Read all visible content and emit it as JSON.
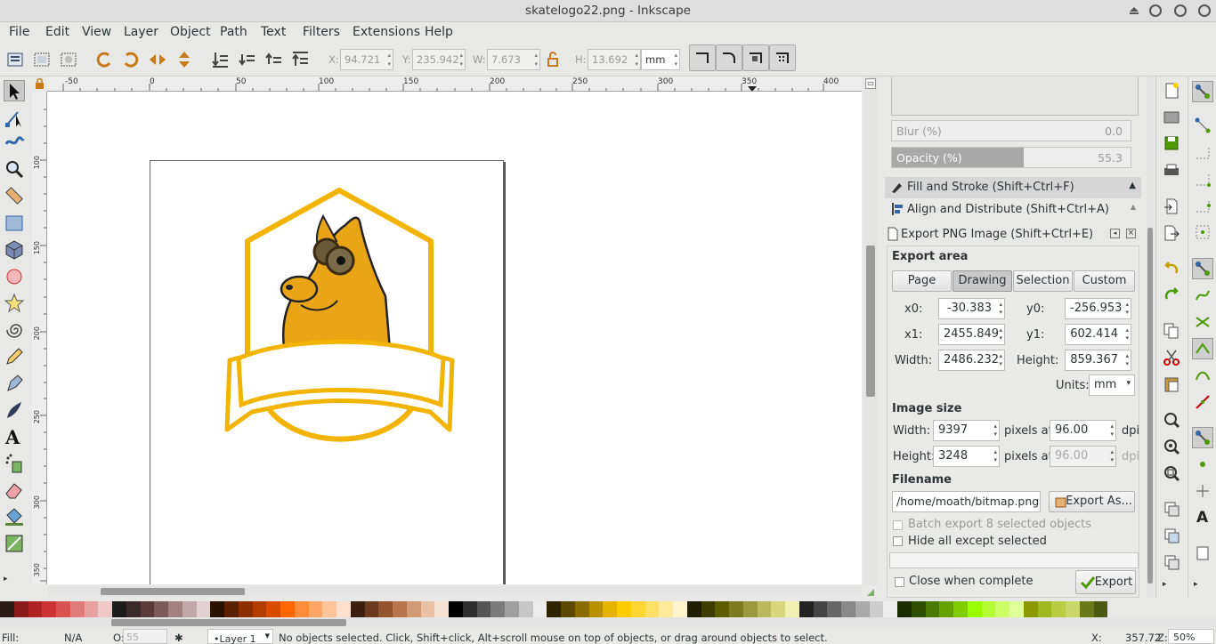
{
  "window": {
    "title": "skatelogo22.png - Inkscape"
  },
  "menu": [
    "File",
    "Edit",
    "View",
    "Layer",
    "Object",
    "Path",
    "Text",
    "Filters",
    "Extensions",
    "Help"
  ],
  "toolbar": {
    "x_label": "X:",
    "x_value": "94.721",
    "y_label": "Y:",
    "y_value": "235.942",
    "w_label": "W:",
    "w_value": "7.673",
    "h_label": "H:",
    "h_value": "13.692",
    "unit": "mm"
  },
  "ruler_h_ticks": [
    "-50",
    "0",
    "50",
    "100",
    "150",
    "200",
    "250",
    "300",
    "350",
    "400"
  ],
  "ruler_v_ticks": [
    "100",
    "150",
    "200",
    "250",
    "300",
    "350"
  ],
  "dock": {
    "blur_label": "Blur (%)",
    "blur_value": "0.0",
    "opacity_label": "Opacity (%)",
    "opacity_value": "55.3",
    "opacity_fraction": 0.553,
    "fill_stroke": "Fill and Stroke (Shift+Ctrl+F)",
    "align": "Align and Distribute (Shift+Ctrl+A)",
    "export_title": "Export PNG Image (Shift+Ctrl+E)",
    "export_area": "Export area",
    "area_tabs": [
      "Page",
      "Drawing",
      "Selection",
      "Custom"
    ],
    "active_area_tab": "Drawing",
    "x0_label": "x0:",
    "x0": "-30.383",
    "y0_label": "y0:",
    "y0": "-256.953",
    "x1_label": "x1:",
    "x1": "2455.849",
    "y1_label": "y1:",
    "y1": "602.414",
    "width_label": "Width:",
    "width": "2486.232",
    "height_label": "Height:",
    "height": "859.367",
    "units_label": "Units:",
    "units": "mm",
    "image_size": "Image size",
    "img_width_label": "Width:",
    "img_width": "9397",
    "img_height_label": "Height:",
    "img_height": "3248",
    "pixels_at": "pixels at",
    "dpi_value": "96.00",
    "dpi_value2": "96.00",
    "dpi": "dpi",
    "filename_label": "Filename",
    "filename": "/home/moath/bitmap.png",
    "export_as": "Export As...",
    "batch": "Batch export 8 selected objects",
    "hide_all": "Hide all except selected",
    "close_when": "Close when complete",
    "export_btn": "Export"
  },
  "status": {
    "fill_label": "Fill:",
    "fill_value": "N/A",
    "o_label": "O:",
    "o_value": "55",
    "layer": "•Layer 1",
    "message": "No objects selected. Click, Shift+click, Alt+scroll mouse on top of objects, or drag around objects to select.",
    "x_label": "X:",
    "x_value": "357.72",
    "z_label": "Z:",
    "zoom": "50%"
  },
  "palette": [
    "#2b1b17",
    "#8b1a1a",
    "#b22222",
    "#cd3333",
    "#d9534f",
    "#e07b7b",
    "#e8a0a0",
    "#f0c8c8",
    "#1c1c1c",
    "#3a2a2a",
    "#5a3a3a",
    "#7a5a5a",
    "#a08080",
    "#c0a8a8",
    "#e0d0d0",
    "#2a1200",
    "#5a2000",
    "#8b2e00",
    "#b33c00",
    "#d94c00",
    "#ff6600",
    "#ff8c3a",
    "#ffa566",
    "#ffc299",
    "#ffe0cc",
    "#3d1f0f",
    "#6b3a1f",
    "#94552e",
    "#b8744a",
    "#d29a74",
    "#e8c0a4",
    "#f5e1d2",
    "#000000",
    "#2e2e2e",
    "#555555",
    "#7b7b7b",
    "#a0a0a0",
    "#c6c6c6",
    "#ececec",
    "#2e2400",
    "#5c4800",
    "#8a6c00",
    "#b89000",
    "#e6b400",
    "#ffcc00",
    "#ffd633",
    "#ffe066",
    "#ffeb99",
    "#fff5cc",
    "#1f1f00",
    "#3d3d00",
    "#5c5c00",
    "#7a7a1f",
    "#99993d",
    "#b8b85c",
    "#d6d67a",
    "#f0f0b0",
    "#222222",
    "#444444",
    "#666666",
    "#888888",
    "#aaaaaa",
    "#cccccc",
    "#eeeeee",
    "#1a2b00",
    "#2f4f00",
    "#4a7a00",
    "#66a300",
    "#80cc00",
    "#99ff00",
    "#b3ff33",
    "#ccff66",
    "#e0ff99",
    "#8a9a00",
    "#a0b820",
    "#b8cc44",
    "#c8d66a",
    "#6a7a1a",
    "#4a5a10"
  ]
}
